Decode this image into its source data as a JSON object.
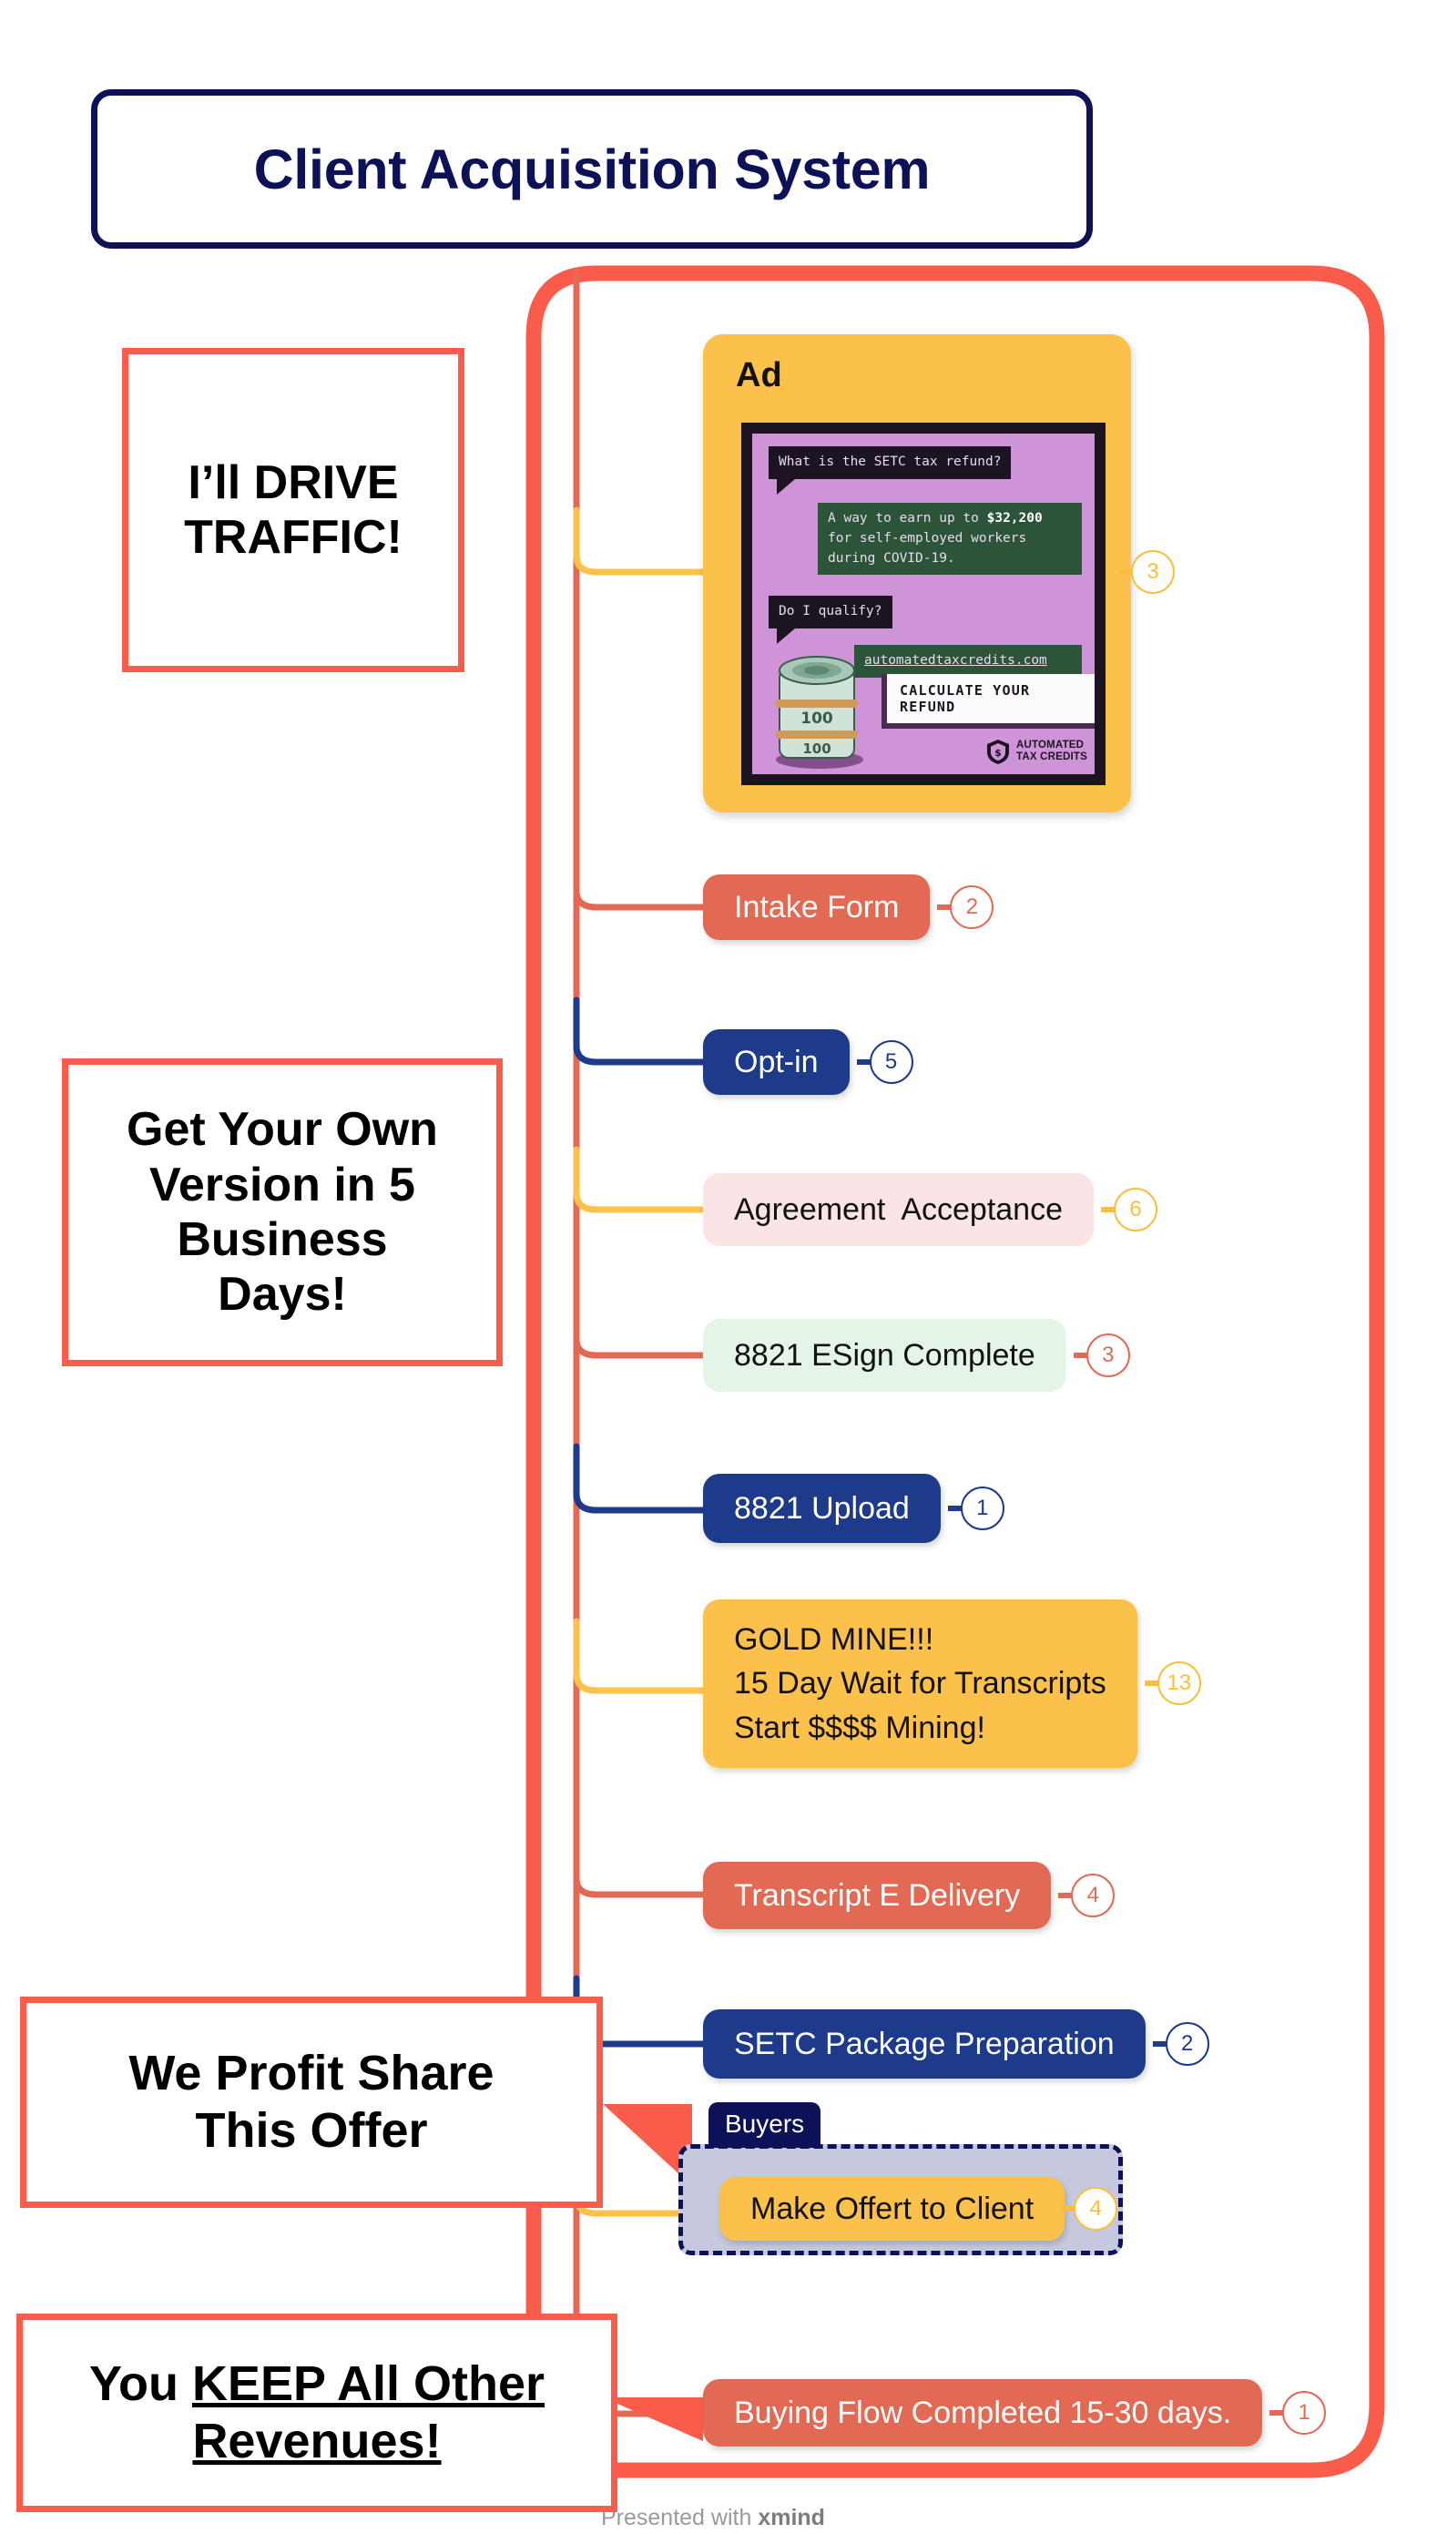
{
  "central": {
    "title": "Client Acquisition System",
    "border_color": "#0d1157",
    "text_color": "#0d1157"
  },
  "theme": {
    "coral": "#e26a55",
    "frame_coral": "#fa5c4b",
    "navy": "#1e3a8a",
    "deep_navy": "#0d1157",
    "yellow": "#fbc14a",
    "badge_yellow": "#fbbe3c",
    "pink_soft": "#fbe4e6",
    "mint_soft": "#e4f5e8",
    "boundary_fill": "#c6c9dd"
  },
  "branches": [
    {
      "id": "ad",
      "label": "Ad",
      "badge": "3",
      "badge_color": "yellow",
      "connector_color": "#fbc14a",
      "fill": "#fbc14a",
      "text_color": "#111111",
      "kind": "image-card"
    },
    {
      "id": "intake-form",
      "label": "Intake Form",
      "badge": "2",
      "badge_color": "coral",
      "connector_color": "#e26a55",
      "fill": "#e26a55",
      "text_color": "#ffffff",
      "kind": "pill"
    },
    {
      "id": "opt-in",
      "label": "Opt-in",
      "badge": "5",
      "badge_color": "navy",
      "connector_color": "#1e3a8a",
      "fill": "#1e3a8a",
      "text_color": "#ffffff",
      "kind": "pill"
    },
    {
      "id": "agreement-acceptance",
      "label": "Agreement  Acceptance",
      "badge": "6",
      "badge_color": "yellow",
      "connector_color": "#fbc14a",
      "fill": "#fbe4e6",
      "text_color": "#111111",
      "kind": "pill"
    },
    {
      "id": "8821-esign-complete",
      "label": "8821 ESign Complete",
      "badge": "3",
      "badge_color": "coral",
      "connector_color": "#e26a55",
      "fill": "#e4f5e8",
      "text_color": "#111111",
      "kind": "pill"
    },
    {
      "id": "8821-upload",
      "label": "8821 Upload",
      "badge": "1",
      "badge_color": "navy",
      "connector_color": "#1e3a8a",
      "fill": "#1e3a8a",
      "text_color": "#ffffff",
      "kind": "pill"
    },
    {
      "id": "gold-mine",
      "label": "GOLD MINE!!!\n15 Day Wait for Transcripts\nStart $$$$ Mining!",
      "badge": "13",
      "badge_color": "yellow",
      "connector_color": "#fbc14a",
      "fill": "#fbc14a",
      "text_color": "#111111",
      "kind": "pill-multiline"
    },
    {
      "id": "transcript-e-delivery",
      "label": "Transcript E Delivery",
      "badge": "4",
      "badge_color": "coral",
      "connector_color": "#e26a55",
      "fill": "#e26a55",
      "text_color": "#ffffff",
      "kind": "pill"
    },
    {
      "id": "setc-package-preparation",
      "label": "SETC Package Preparation",
      "badge": "2",
      "badge_color": "navy",
      "connector_color": "#1e3a8a",
      "fill": "#1e3a8a",
      "text_color": "#ffffff",
      "kind": "pill"
    },
    {
      "id": "make-offert-to-client",
      "label": "Make Offert to Client",
      "badge": "4",
      "badge_color": "yellow",
      "connector_color": "#fbc14a",
      "fill": "#fbc14a",
      "text_color": "#111111",
      "kind": "pill"
    },
    {
      "id": "buying-flow-completed",
      "label": "Buying Flow Completed 15-30 days.",
      "badge": "1",
      "badge_color": "coral",
      "connector_color": "#e26a55",
      "fill": "#e26a55",
      "text_color": "#ffffff",
      "kind": "pill"
    }
  ],
  "boundary": {
    "label": "Buyers",
    "wraps": "make-offert-to-client",
    "style": "dashed"
  },
  "callouts": [
    {
      "id": "drive-traffic",
      "lines": [
        "I’ll DRIVE",
        "TRAFFIC!"
      ]
    },
    {
      "id": "own-version",
      "lines": [
        "Get Your Own",
        "Version in 5",
        "Business",
        "Days!"
      ]
    },
    {
      "id": "profit-share",
      "lines": [
        "We Profit Share",
        "This Offer"
      ]
    },
    {
      "id": "keep-revenues",
      "plain": "You ",
      "underlined": [
        "KEEP All Other",
        "Revenues!"
      ]
    }
  ],
  "ad_creative": {
    "card_title": "Ad",
    "question_1": "What is the SETC tax refund?",
    "answer_1_pre": "A way to earn up to ",
    "answer_1_amount": "$32,200",
    "answer_1_post": "\nfor self-employed workers\nduring COVID-19.",
    "question_2": "Do I qualify?",
    "answer_2_url": "automatedtaxcredits.com",
    "cta_label": "CALCULATE YOUR REFUND",
    "brand_line_1": "AUTOMATED",
    "brand_line_2": "TAX CREDITS"
  },
  "watermark": {
    "prefix": "Presented with ",
    "brand": "xmind"
  }
}
